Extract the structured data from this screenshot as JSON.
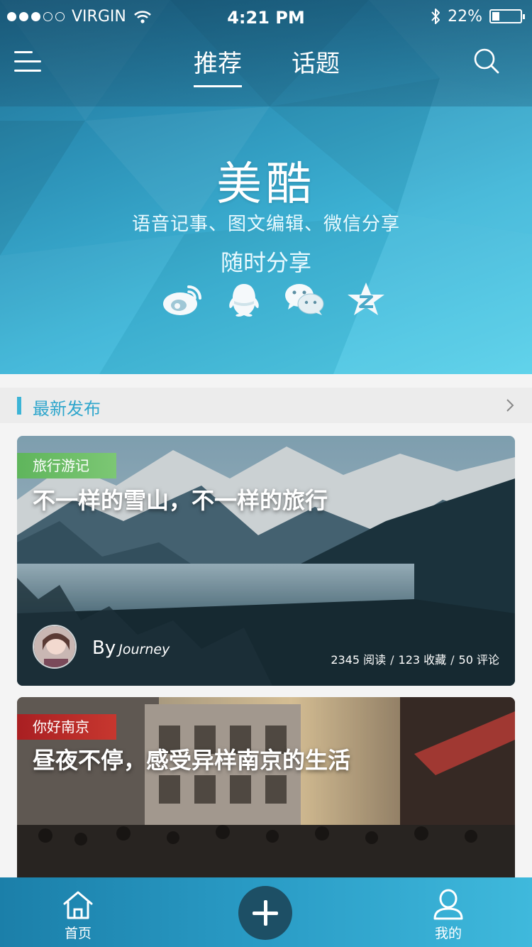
{
  "status_bar": {
    "carrier": "VIRGIN",
    "signal_bars": 3,
    "signal_total": 5,
    "time": "4:21 PM",
    "battery_percent": "22%",
    "battery_level": 0.22,
    "icons": [
      "wifi-icon",
      "bluetooth-icon",
      "battery-icon"
    ]
  },
  "nav": {
    "menu_icon": "menu-icon",
    "tabs": [
      {
        "label": "推荐",
        "active": true
      },
      {
        "label": "话题",
        "active": false
      }
    ],
    "search_icon": "search-icon"
  },
  "hero": {
    "brand": "美酷",
    "slogan": "语音记事、图文编辑、微信分享",
    "share_text": "随时分享",
    "social_icons": [
      "weibo-icon",
      "qq-icon",
      "wechat-icon",
      "qzone-icon"
    ]
  },
  "section": {
    "title": "最新发布",
    "more_icon": "chevron-right-icon"
  },
  "posts": [
    {
      "tag": "旅行游记",
      "tag_color": "#5fb55c",
      "title": "不一样的雪山，不一样的旅行",
      "author_prefix": "By",
      "author": "Journey",
      "stats": {
        "reads": "2345 阅读",
        "favorites": "123 收藏",
        "comments": "50 评论"
      }
    },
    {
      "tag": "你好南京",
      "tag_color": "#b02a27",
      "title": "昼夜不停，感受异样南京的生活"
    }
  ],
  "tab_bar": {
    "items": [
      {
        "label": "首页",
        "icon": "home-icon"
      },
      {
        "label": "我的",
        "icon": "user-icon"
      }
    ],
    "add_icon": "plus-icon"
  },
  "colors": {
    "accent": "#3cb4d6",
    "tab_bar": "#2a9cc6",
    "add_button": "#1d4f65"
  }
}
